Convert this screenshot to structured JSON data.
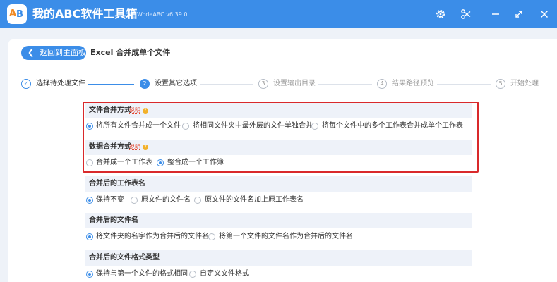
{
  "app": {
    "title": "我的ABC软件工具箱",
    "version": "WodeABC v6.39.0",
    "logo_letters": "AB",
    "window_icons": [
      "gear-icon",
      "scissors-icon",
      "minimize-icon",
      "expand-icon",
      "close-icon"
    ]
  },
  "header": {
    "back_label": "返回到主面板",
    "page_title": "Excel 合并成单个文件"
  },
  "steps": [
    {
      "num": "✓",
      "label": "选择待处理文件",
      "state": "done"
    },
    {
      "num": "2",
      "label": "设置其它选项",
      "state": "active"
    },
    {
      "num": "3",
      "label": "设置输出目录",
      "state": "pending"
    },
    {
      "num": "4",
      "label": "结果路径预览",
      "state": "pending"
    },
    {
      "num": "5",
      "label": "开始处理",
      "state": "pending"
    }
  ],
  "sections": {
    "file_merge": {
      "title": "文件合并方式",
      "help": "说明",
      "options": [
        "将所有文件合并成一个文件",
        "将相同文件夹中最外层的文件单独合并",
        "将每个文件中的多个工作表合并成单个工作表"
      ],
      "selected": 0
    },
    "data_merge": {
      "title": "数据合并方式",
      "help": "说明",
      "options": [
        "合并成一个工作表",
        "整合成一个工作簿"
      ],
      "selected": 1
    },
    "sheet_name": {
      "title": "合并后的工作表名",
      "options": [
        "保持不变",
        "原文件的文件名",
        "原文件的文件名加上原工作表名"
      ],
      "selected": 0
    },
    "file_name": {
      "title": "合并后的文件名",
      "options": [
        "将文件夹的名字作为合并后的文件名",
        "将第一个文件的文件名作为合并后的文件名"
      ],
      "selected": 0
    },
    "file_format": {
      "title": "合并后的文件格式类型",
      "options": [
        "保持与第一个文件的格式相同",
        "自定义文件格式"
      ],
      "selected": 0
    }
  },
  "colors": {
    "accent": "#3b8de8",
    "highlight": "#d9292b",
    "help": "#e4452e"
  }
}
